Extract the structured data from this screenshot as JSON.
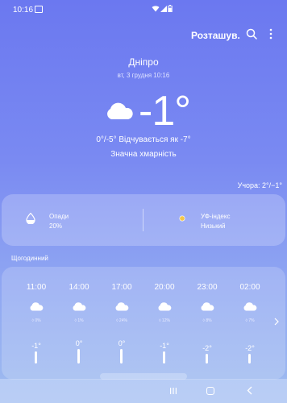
{
  "status_bar": {
    "time": "10:16"
  },
  "header": {
    "locations_label": "Розташув."
  },
  "location": {
    "city": "Дніпро",
    "date": "вт, 3 грудня 10:16"
  },
  "current": {
    "temp": "-1°",
    "range_feels": "0°/-5° Відчувається як -7°",
    "condition": "Значна хмарність",
    "yesterday": "Учора: 2°/−1°"
  },
  "details": {
    "precip_label": "Опади",
    "precip_value": "20%",
    "uv_label": "УФ-індекс",
    "uv_value": "Низький"
  },
  "hourly": {
    "title": "Щогодинний",
    "items": [
      {
        "time": "11:00",
        "precip": "◊ 0%",
        "temp": "-1°",
        "temp_num": -1
      },
      {
        "time": "14:00",
        "precip": "◊ 1%",
        "temp": "0°",
        "temp_num": 0
      },
      {
        "time": "17:00",
        "precip": "◊ 24%",
        "temp": "0°",
        "temp_num": 0
      },
      {
        "time": "20:00",
        "precip": "◊ 12%",
        "temp": "-1°",
        "temp_num": -1
      },
      {
        "time": "23:00",
        "precip": "◊ 8%",
        "temp": "-2°",
        "temp_num": -2
      },
      {
        "time": "02:00",
        "precip": "◊ 7%",
        "temp": "-2°",
        "temp_num": -2
      }
    ]
  }
}
